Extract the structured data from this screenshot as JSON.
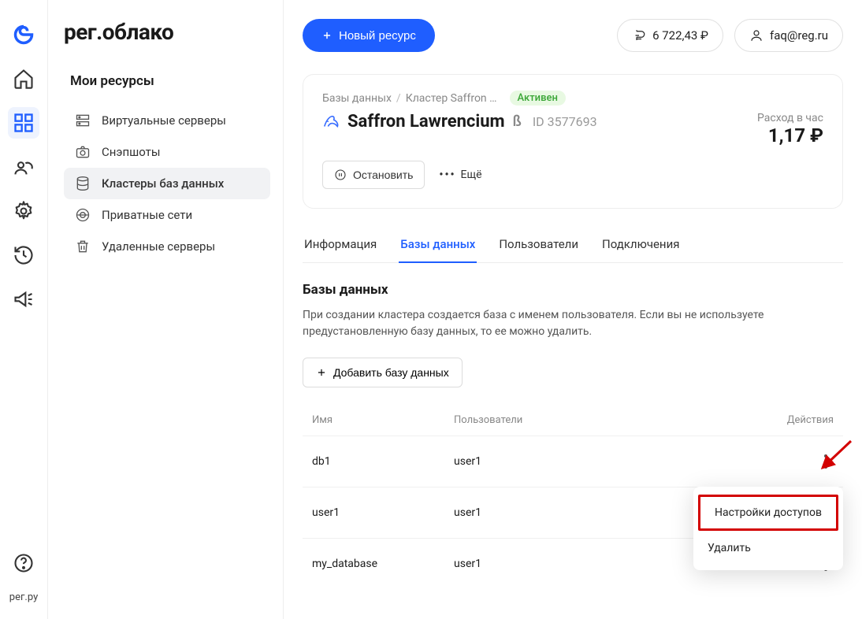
{
  "brand": "рег.облако",
  "footer_text": "рег.ру",
  "topbar": {
    "new_resource_label": "Новый ресурс",
    "balance": "6 722,43 ₽",
    "account": "faq@reg.ru"
  },
  "sidebar": {
    "title": "Мои ресурсы",
    "items": [
      {
        "label": "Виртуальные серверы"
      },
      {
        "label": "Снэпшоты"
      },
      {
        "label": "Кластеры баз данных"
      },
      {
        "label": "Приватные сети"
      },
      {
        "label": "Удаленные серверы"
      }
    ]
  },
  "breadcrumb": {
    "root": "Базы данных",
    "cluster": "Кластер Saffron …",
    "status": "Активен"
  },
  "cluster": {
    "name": "Saffron Lawrencium",
    "beta": "ß",
    "id_label": "ID 3577693",
    "usage_label": "Расход в час",
    "usage_value": "1,17 ₽",
    "stop_label": "Остановить",
    "more_label": "Ещё"
  },
  "tabs": [
    {
      "label": "Информация"
    },
    {
      "label": "Базы данных"
    },
    {
      "label": "Пользователи"
    },
    {
      "label": "Подключения"
    }
  ],
  "databases": {
    "title": "Базы данных",
    "description": "При создании кластера создается база с именем пользователя. Если вы не используете предустановленную базу данных, то ее можно удалить.",
    "add_label": "Добавить базу данных",
    "columns": {
      "name": "Имя",
      "users": "Пользователи",
      "actions": "Действия"
    },
    "rows": [
      {
        "name": "db1",
        "user": "user1"
      },
      {
        "name": "user1",
        "user": "user1"
      },
      {
        "name": "my_database",
        "user": "user1"
      }
    ]
  },
  "row_menu": {
    "access": "Настройки доступов",
    "delete": "Удалить"
  }
}
